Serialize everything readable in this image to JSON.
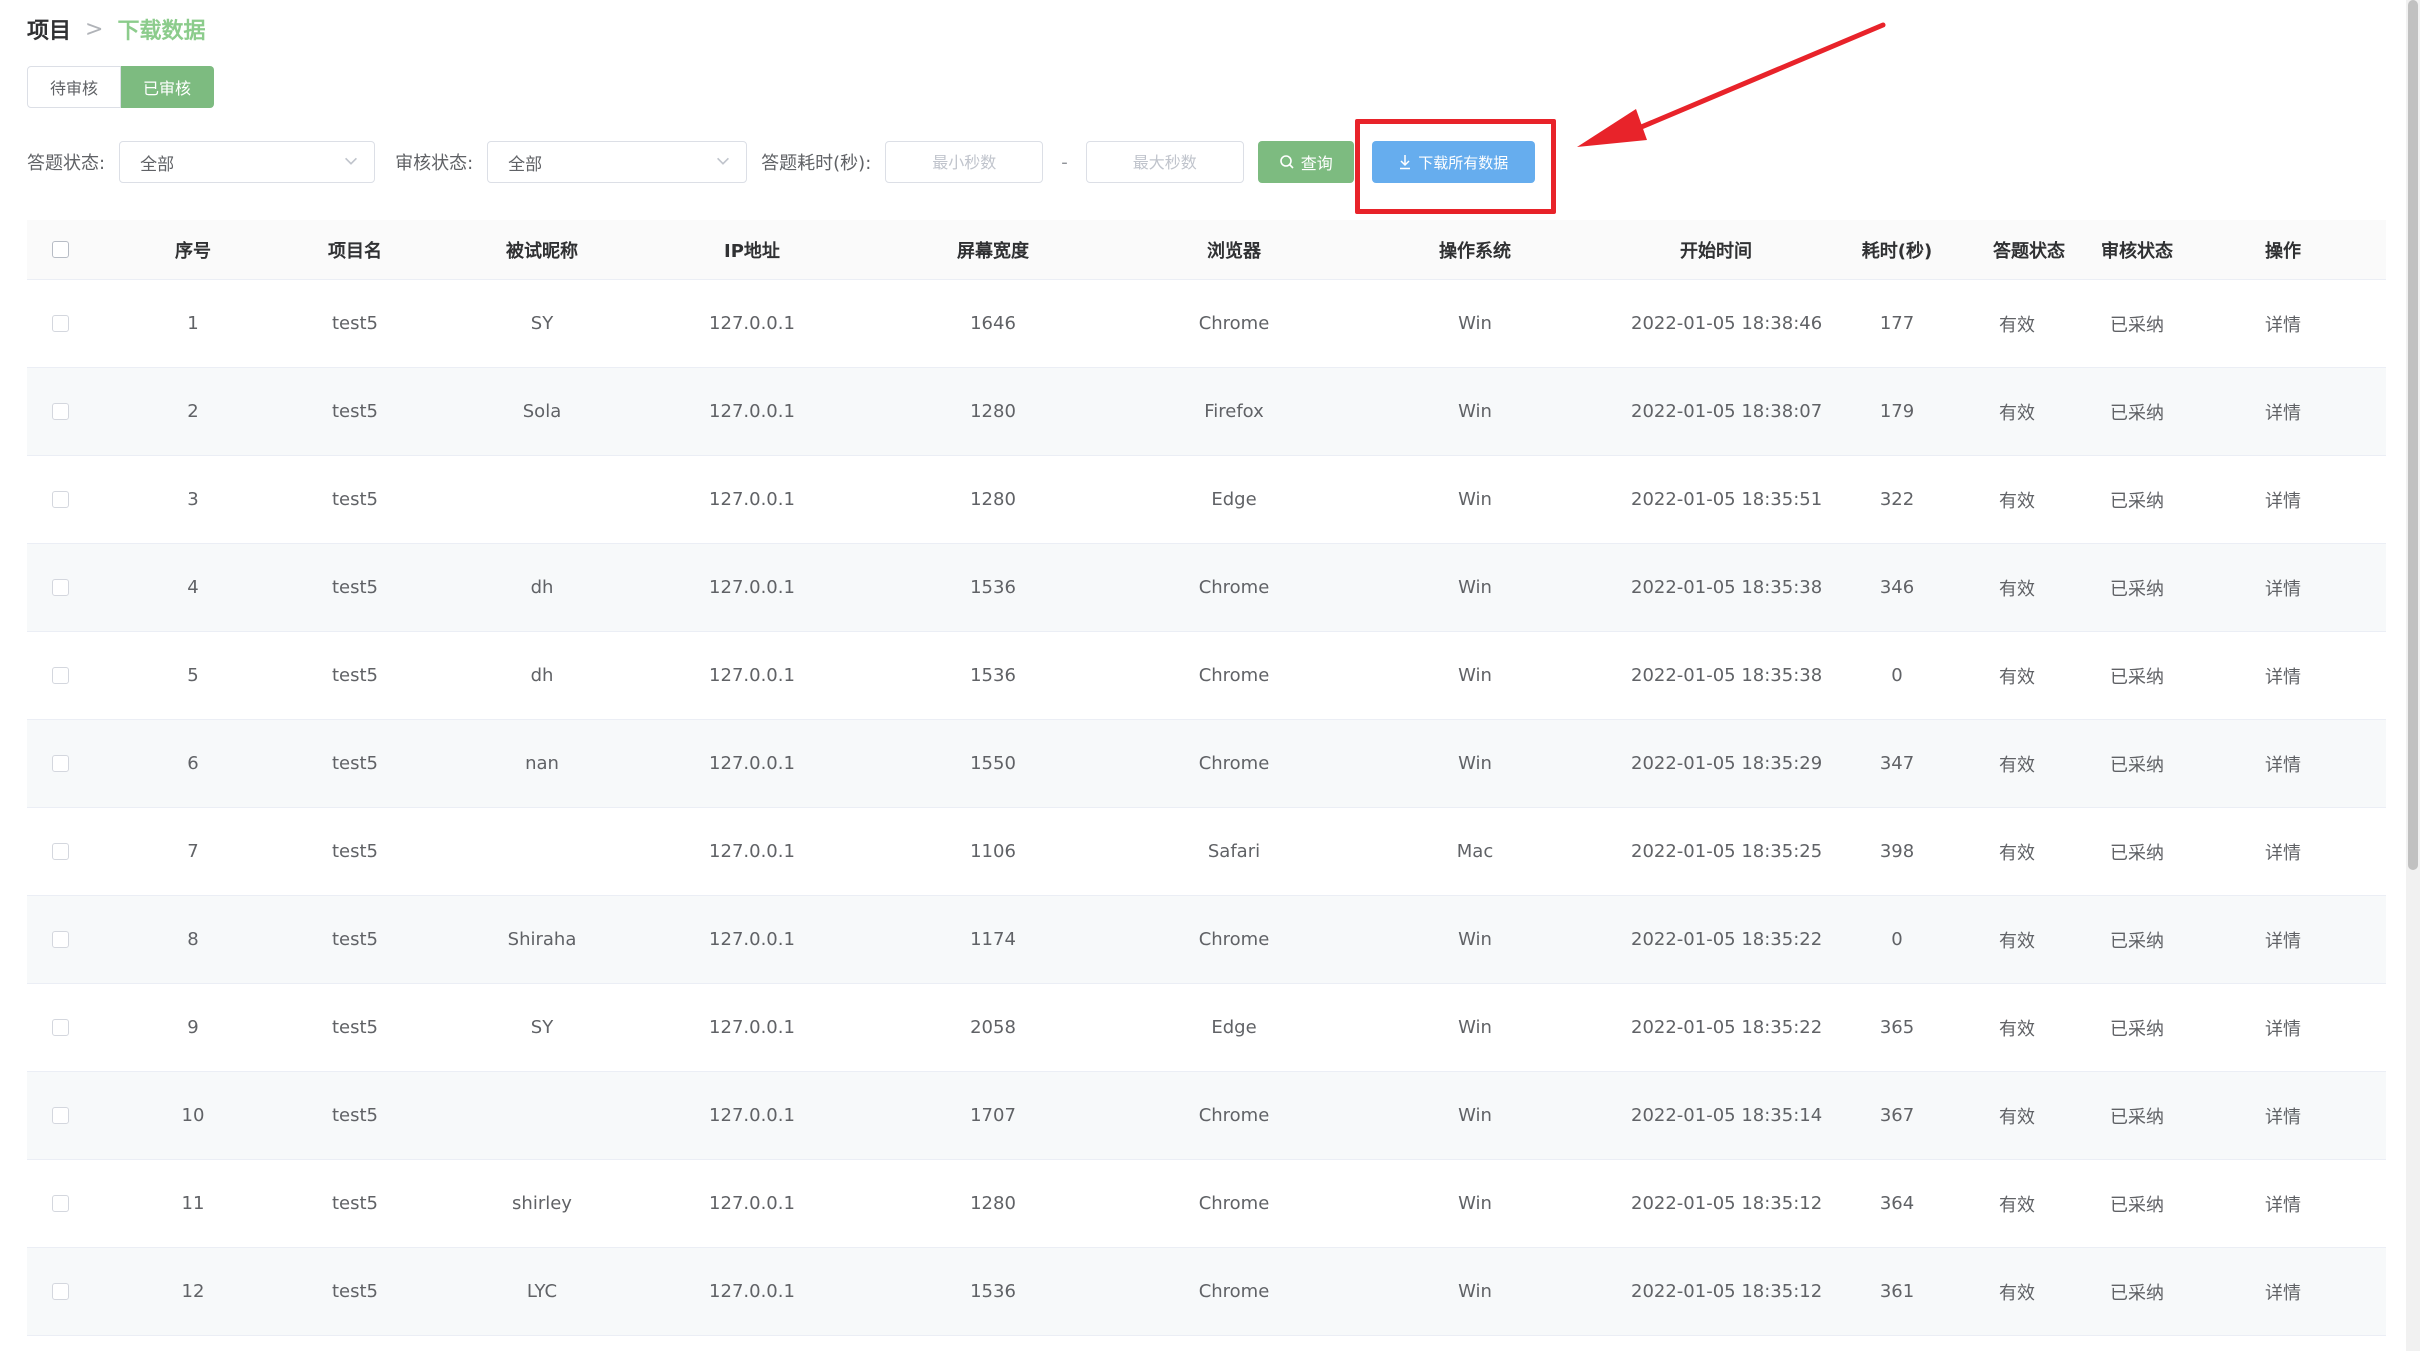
{
  "breadcrumb": {
    "root": "项目",
    "separator": ">",
    "current": "下载数据"
  },
  "tabs": [
    {
      "label": "待审核",
      "active": false
    },
    {
      "label": "已审核",
      "active": true
    }
  ],
  "filters": {
    "answer_status_label": "答题状态:",
    "answer_status_value": "全部",
    "review_status_label": "审核状态:",
    "review_status_value": "全部",
    "duration_label": "答题耗时(秒):",
    "min_placeholder": "最小秒数",
    "max_placeholder": "最大秒数",
    "dash": "-",
    "query_label": "查询",
    "download_label": "下载所有数据"
  },
  "colors": {
    "primary_green": "#7dbb80",
    "download_blue": "#66adee",
    "highlight_red": "#e8232a"
  },
  "table": {
    "headers": [
      "序号",
      "项目名",
      "被试昵称",
      "IP地址",
      "屏幕宽度",
      "浏览器",
      "操作系统",
      "开始时间",
      "耗时(秒)",
      "答题状态",
      "审核状态",
      "操作"
    ],
    "rows": [
      [
        "1",
        "test5",
        "SY",
        "127.0.0.1",
        "1646",
        "Chrome",
        "Win",
        "2022-01-05 18:38:46",
        "177",
        "有效",
        "已采纳",
        "详情"
      ],
      [
        "2",
        "test5",
        "Sola",
        "127.0.0.1",
        "1280",
        "Firefox",
        "Win",
        "2022-01-05 18:38:07",
        "179",
        "有效",
        "已采纳",
        "详情"
      ],
      [
        "3",
        "test5",
        "",
        "127.0.0.1",
        "1280",
        "Edge",
        "Win",
        "2022-01-05 18:35:51",
        "322",
        "有效",
        "已采纳",
        "详情"
      ],
      [
        "4",
        "test5",
        "dh",
        "127.0.0.1",
        "1536",
        "Chrome",
        "Win",
        "2022-01-05 18:35:38",
        "346",
        "有效",
        "已采纳",
        "详情"
      ],
      [
        "5",
        "test5",
        "dh",
        "127.0.0.1",
        "1536",
        "Chrome",
        "Win",
        "2022-01-05 18:35:38",
        "0",
        "有效",
        "已采纳",
        "详情"
      ],
      [
        "6",
        "test5",
        "nan",
        "127.0.0.1",
        "1550",
        "Chrome",
        "Win",
        "2022-01-05 18:35:29",
        "347",
        "有效",
        "已采纳",
        "详情"
      ],
      [
        "7",
        "test5",
        "",
        "127.0.0.1",
        "1106",
        "Safari",
        "Mac",
        "2022-01-05 18:35:25",
        "398",
        "有效",
        "已采纳",
        "详情"
      ],
      [
        "8",
        "test5",
        "Shiraha",
        "127.0.0.1",
        "1174",
        "Chrome",
        "Win",
        "2022-01-05 18:35:22",
        "0",
        "有效",
        "已采纳",
        "详情"
      ],
      [
        "9",
        "test5",
        "SY",
        "127.0.0.1",
        "2058",
        "Edge",
        "Win",
        "2022-01-05 18:35:22",
        "365",
        "有效",
        "已采纳",
        "详情"
      ],
      [
        "10",
        "test5",
        "",
        "127.0.0.1",
        "1707",
        "Chrome",
        "Win",
        "2022-01-05 18:35:14",
        "367",
        "有效",
        "已采纳",
        "详情"
      ],
      [
        "11",
        "test5",
        "shirley",
        "127.0.0.1",
        "1280",
        "Chrome",
        "Win",
        "2022-01-05 18:35:12",
        "364",
        "有效",
        "已采纳",
        "详情"
      ],
      [
        "12",
        "test5",
        "LYC",
        "127.0.0.1",
        "1536",
        "Chrome",
        "Win",
        "2022-01-05 18:35:12",
        "361",
        "有效",
        "已采纳",
        "详情"
      ]
    ]
  }
}
